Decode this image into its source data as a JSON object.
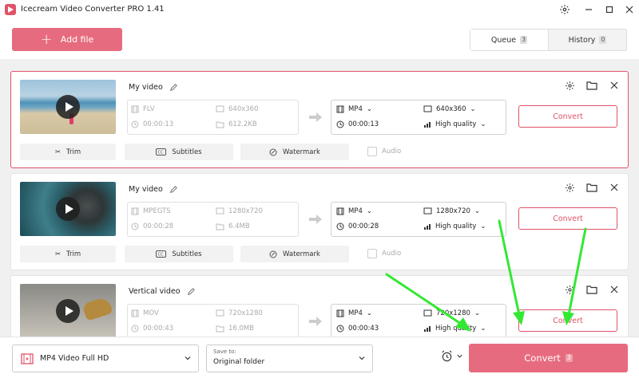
{
  "app": {
    "title": "Icecream Video Converter PRO 1.41"
  },
  "toolbar": {
    "add_file_label": "Add file"
  },
  "tabs": [
    {
      "label": "Queue",
      "count": "3"
    },
    {
      "label": "History",
      "count": "0"
    }
  ],
  "videos": [
    {
      "title": "My video",
      "src_format": "FLV",
      "src_resolution": "640x360",
      "src_duration": "00:00:13",
      "src_size": "612.2KB",
      "dst_format": "MP4",
      "dst_resolution": "640x360",
      "dst_duration": "00:00:13",
      "dst_quality": "High quality"
    },
    {
      "title": "My video",
      "src_format": "MPEGTS",
      "src_resolution": "1280x720",
      "src_duration": "00:00:28",
      "src_size": "6.4MB",
      "dst_format": "MP4",
      "dst_resolution": "1280x720",
      "dst_duration": "00:00:28",
      "dst_quality": "High quality"
    },
    {
      "title": "Vertical video",
      "src_format": "MOV",
      "src_resolution": "720x1280",
      "src_duration": "00:00:43",
      "src_size": "16.0MB",
      "dst_format": "MP4",
      "dst_resolution": "720x1280",
      "dst_duration": "00:00:43",
      "dst_quality": "High quality"
    }
  ],
  "card_labels": {
    "trim": "Trim",
    "subtitles": "Subtitles",
    "watermark": "Watermark",
    "audio": "Audio",
    "convert": "Convert"
  },
  "bottom": {
    "format_value": "MP4 Video Full HD",
    "save_label": "Save to:",
    "save_value": "Original folder",
    "convert_label": "Convert",
    "convert_count": "3"
  },
  "colors": {
    "accent": "#e76b7e",
    "accent_border": "#e05368",
    "annotation": "#33e833"
  }
}
